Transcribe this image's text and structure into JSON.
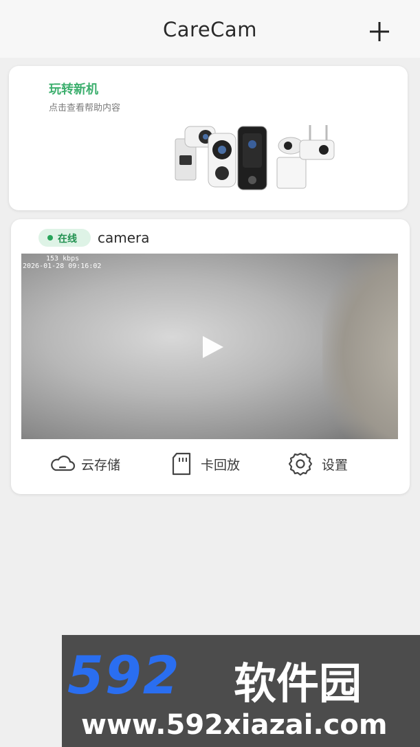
{
  "header": {
    "title": "CareCam",
    "add_icon": "plus-icon"
  },
  "promo": {
    "title": "玩转新机",
    "subtitle": "点击查看帮助内容"
  },
  "camera": {
    "status": "在线",
    "name": "camera",
    "osd_bitrate": "153 kbps",
    "osd_timestamp": "2026-01-28 09:16:02",
    "actions": [
      {
        "label": "云存储",
        "icon": "cloud-icon"
      },
      {
        "label": "卡回放",
        "icon": "sd-card-icon"
      },
      {
        "label": "设置",
        "icon": "gear-icon"
      }
    ]
  },
  "watermark": {
    "number": "592",
    "name": "软件园",
    "url": "www.592xiazai.com"
  },
  "colors": {
    "accent_green": "#3daf6e",
    "online_green": "#27a55a",
    "watermark_blue": "#2a6ef0"
  }
}
